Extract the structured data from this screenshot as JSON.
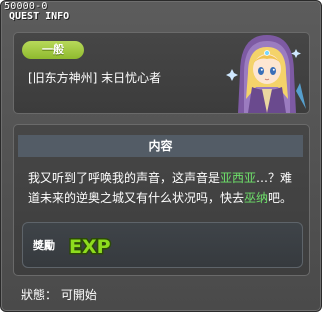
{
  "window": {
    "quest_id": "50000-0",
    "title": "QUEST INFO"
  },
  "quest": {
    "category": "一般",
    "name": "[旧东方神州] 末日忧心者"
  },
  "content": {
    "header": "内容",
    "desc_part1": "我又听到了呼唤我的声音，这声音是",
    "desc_highlight1": "亚西亚",
    "desc_part2": "…？难道未来的逆奥之城又有什么状况吗，快去",
    "desc_highlight2": "巫纳",
    "desc_part3": "吧。"
  },
  "reward": {
    "label": "獎勵",
    "items": [
      "EXP"
    ]
  },
  "status": "狀態： 可開始",
  "colors": {
    "highlight": "#6ee06a",
    "badge": "#9ac83a",
    "exp": "#8edc1e"
  },
  "icons": {
    "portrait": "hooded-sorceress-portrait",
    "reward": "exp-icon"
  }
}
